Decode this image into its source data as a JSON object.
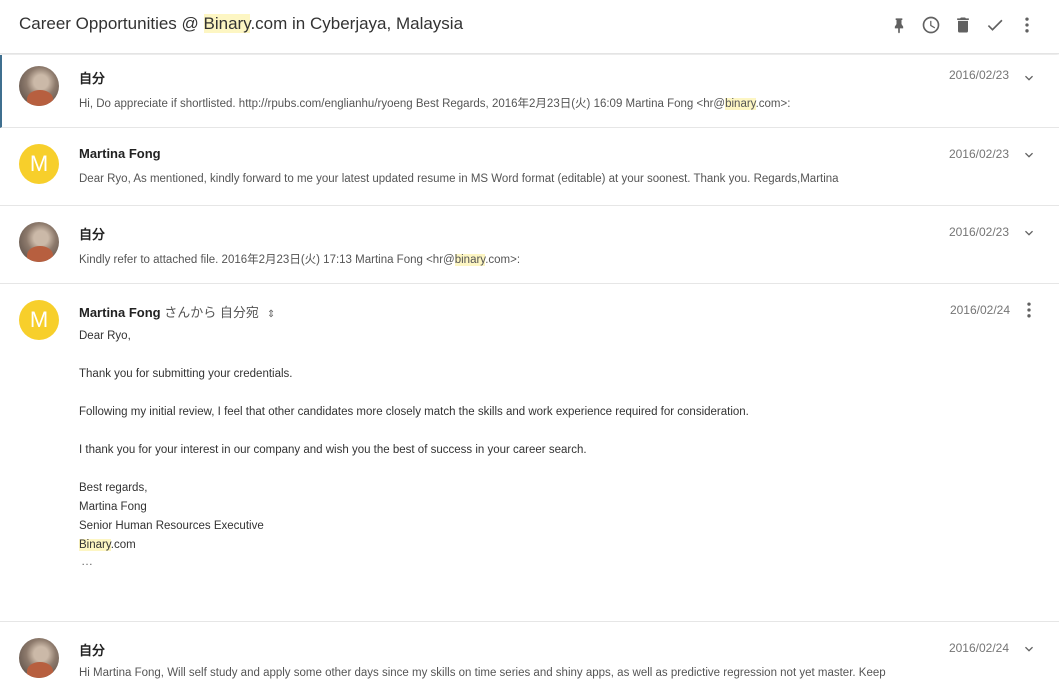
{
  "header": {
    "subject_pre": "Career Opportunities @ ",
    "subject_hl": "Binary",
    "subject_post": ".com in Cyberjaya, Malaysia",
    "actions": [
      "pin-icon",
      "snooze-clock-icon",
      "trash-icon",
      "done-check-icon",
      "more-vert-icon"
    ]
  },
  "messages": [
    {
      "sender": "自分",
      "date": "2016/02/23",
      "snippet_pre": "Hi, Do appreciate if shortlisted. http://rpubs.com/englianhu/ryoeng Best Regards, 2016年2月23日(火) 16:09 Martina Fong <hr@",
      "snippet_hl": "binary",
      "snippet_post": ".com>:"
    },
    {
      "sender": "Martina Fong",
      "avatar_letter": "M",
      "date": "2016/02/23",
      "snippet": "Dear Ryo, As mentioned, kindly forward to me your latest updated resume in MS Word format (editable) at your soonest. Thank you. Regards,Martina"
    },
    {
      "sender": "自分",
      "date": "2016/02/23",
      "snippet_pre": "Kindly refer to attached file. 2016年2月23日(火) 17:13 Martina Fong <hr@",
      "snippet_hl": "binary",
      "snippet_post": ".com>:"
    },
    {
      "sender": "Martina Fong",
      "recipient": " さんから 自分宛",
      "avatar_letter": "M",
      "date": "2016/02/24",
      "body": {
        "greeting": "Dear Ryo,",
        "line1": "Thank you for submitting your credentials.",
        "line2": "Following my initial review, I feel that other candidates more closely match the skills and work experience required for consideration.",
        "line3": "I thank you for your interest in our company and wish you the best of success in your career search.",
        "sign1": "Best regards,",
        "sign2": "Martina Fong",
        "sign3": "Senior Human Resources Executive",
        "sign4_hl": "Binary",
        "sign4_post": ".com",
        "more": "…"
      }
    },
    {
      "sender": "自分",
      "date": "2016/02/24",
      "snippet": "Hi Martina Fong, Will self study and apply some other days since my skills on time series and shiny apps, as well as predictive regression not yet master. Keep"
    }
  ]
}
